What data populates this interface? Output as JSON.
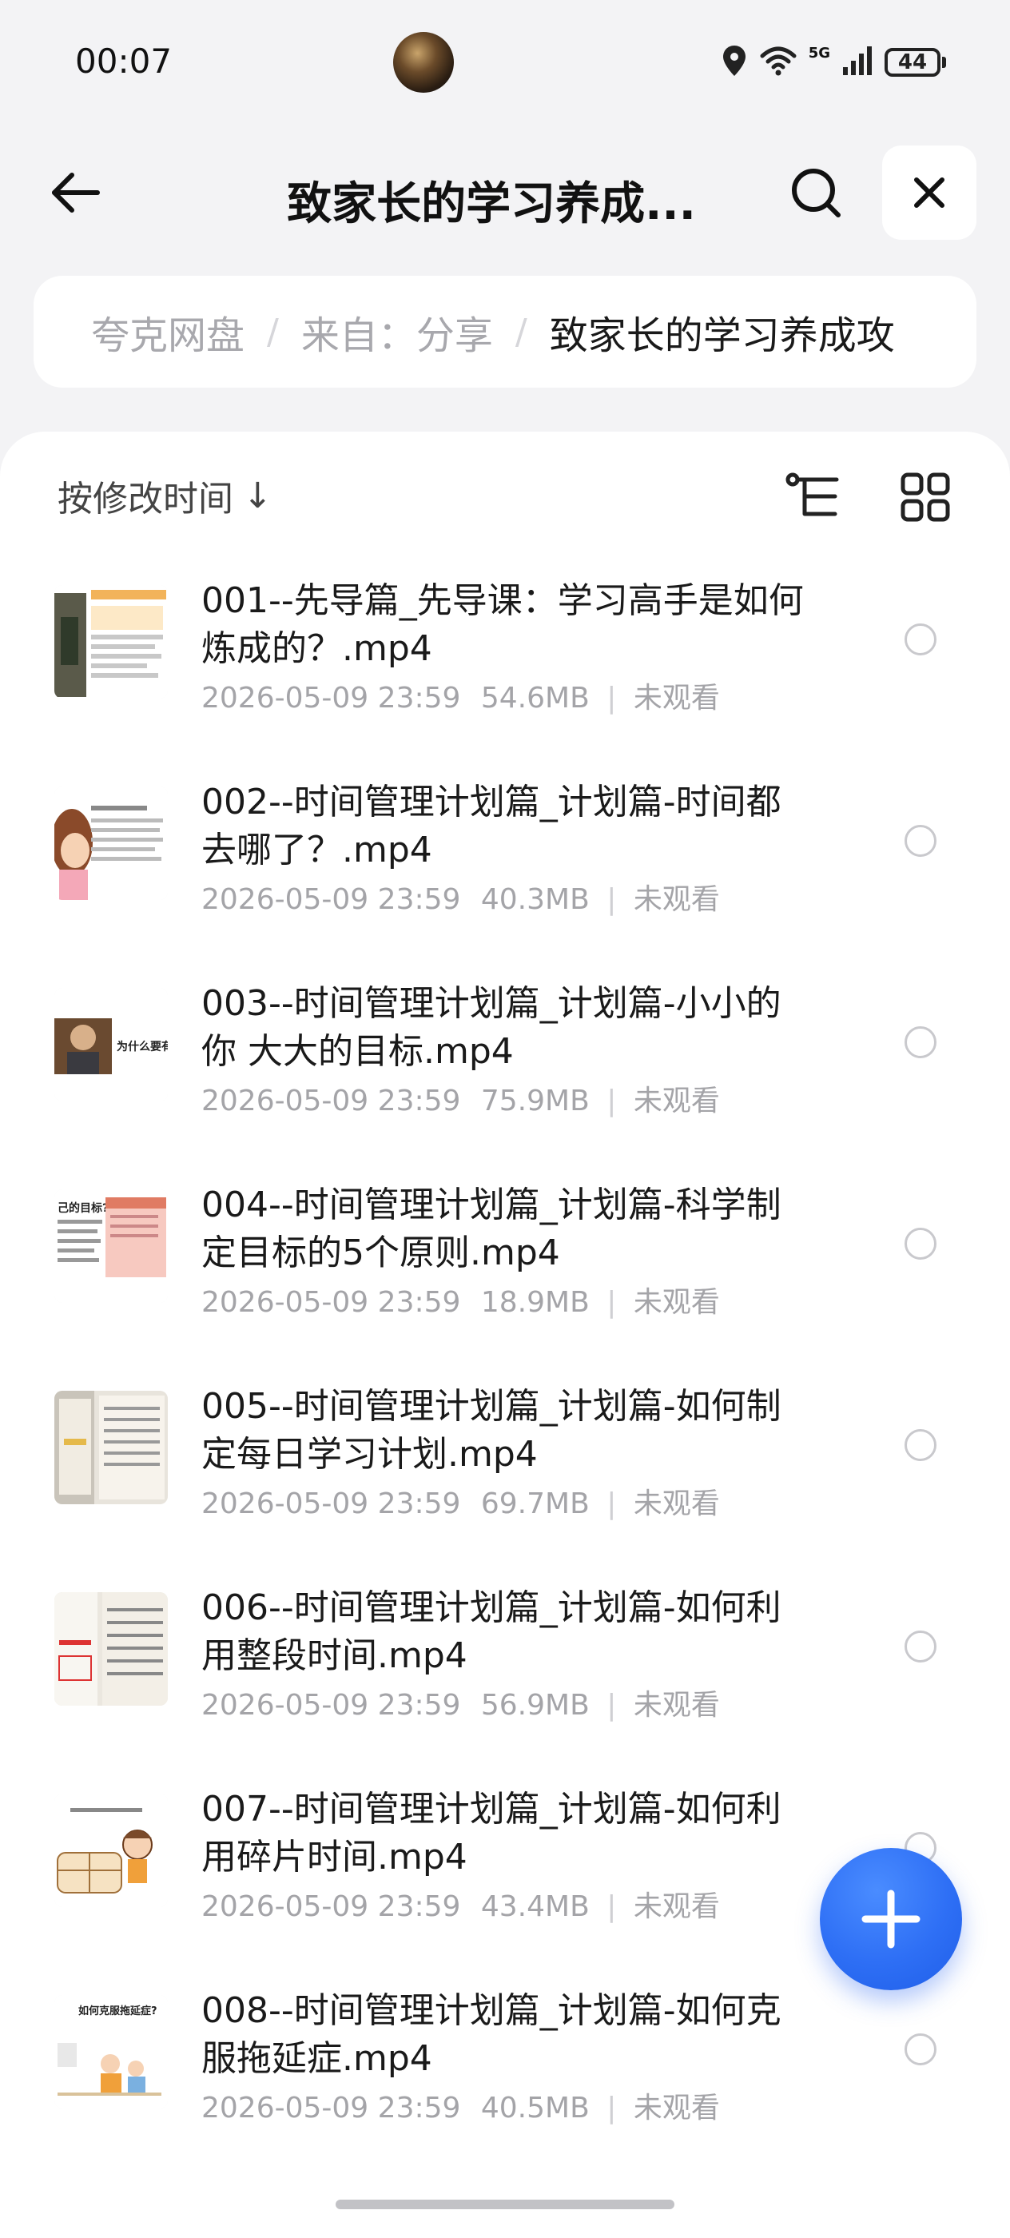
{
  "status_bar": {
    "time": "00:07",
    "battery": "44",
    "network": "5G"
  },
  "header": {
    "title": "致家长的学习养成..."
  },
  "breadcrumb": {
    "items": [
      "夸克网盘",
      "来自：分享",
      "致家长的学习养成攻"
    ]
  },
  "toolbar": {
    "sort_label": "按修改时间",
    "sort_arrow": "↓"
  },
  "files": [
    {
      "name": "001--先导篇_先导课：学习高手是如何炼成的？.mp4",
      "date": "2026-05-09 23:59",
      "size": "54.6MB",
      "status": "未观看",
      "thumb": "doc-orange"
    },
    {
      "name": "002--时间管理计划篇_计划篇-时间都去哪了？.mp4",
      "date": "2026-05-09 23:59",
      "size": "40.3MB",
      "status": "未观看",
      "thumb": "cartoon-girl"
    },
    {
      "name": "003--时间管理计划篇_计划篇-小小的你 大大的目标.mp4",
      "date": "2026-05-09 23:59",
      "size": "75.9MB",
      "status": "未观看",
      "thumb": "photo-person",
      "thumb_text": "为什么要有"
    },
    {
      "name": "004--时间管理计划篇_计划篇-科学制定目标的5个原则.mp4",
      "date": "2026-05-09 23:59",
      "size": "18.9MB",
      "status": "未观看",
      "thumb": "doc-pink",
      "thumb_text": "己的目标?"
    },
    {
      "name": "005--时间管理计划篇_计划篇-如何制定每日学习计划.mp4",
      "date": "2026-05-09 23:59",
      "size": "69.7MB",
      "status": "未观看",
      "thumb": "notebook-photo"
    },
    {
      "name": "006--时间管理计划篇_计划篇-如何利用整段时间.mp4",
      "date": "2026-05-09 23:59",
      "size": "56.9MB",
      "status": "未观看",
      "thumb": "paper-photo"
    },
    {
      "name": "007--时间管理计划篇_计划篇-如何利用碎片时间.mp4",
      "date": "2026-05-09 23:59",
      "size": "43.4MB",
      "status": "未观看",
      "thumb": "cartoon-boy"
    },
    {
      "name": "008--时间管理计划篇_计划篇-如何克服拖延症.mp4",
      "date": "2026-05-09 23:59",
      "size": "40.5MB",
      "status": "未观看",
      "thumb": "cartoon-family",
      "thumb_text": "如何克服拖延症?"
    }
  ],
  "colors": {
    "accent": "#2E6FF5",
    "text": "#1A1A1A",
    "meta": "#A4A4A8",
    "background": "#F3F3F5"
  }
}
